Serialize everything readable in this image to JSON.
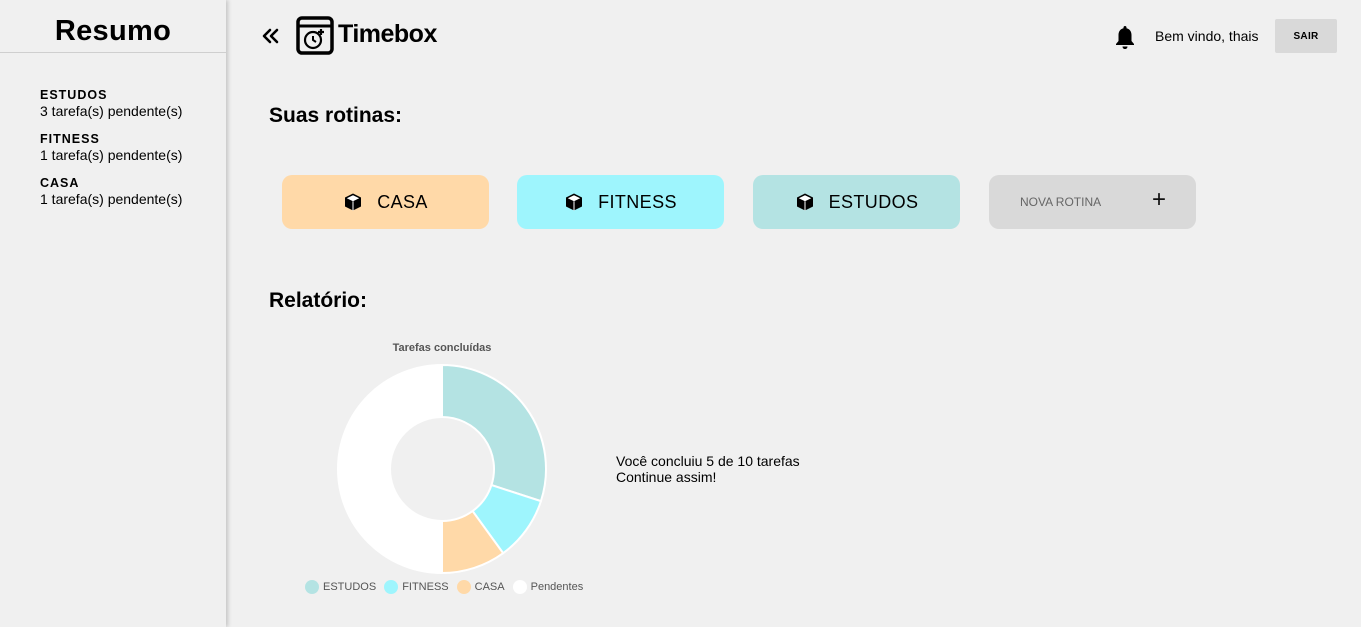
{
  "sidebar": {
    "title": "Resumo",
    "items": [
      {
        "name": "ESTUDOS",
        "count": "3 tarefa(s) pendente(s)"
      },
      {
        "name": "FITNESS",
        "count": "1 tarefa(s) pendente(s)"
      },
      {
        "name": "CASA",
        "count": "1 tarefa(s) pendente(s)"
      }
    ]
  },
  "header": {
    "logo_text": "Timebox",
    "welcome": "Bem vindo, thais",
    "logout_label": "SAIR"
  },
  "routines": {
    "title": "Suas rotinas:",
    "items": [
      {
        "label": "CASA",
        "color": "#ffd9a8"
      },
      {
        "label": "FITNESS",
        "color": "#9ef5fd"
      },
      {
        "label": "ESTUDOS",
        "color": "#b4e3e3"
      }
    ],
    "new_label": "NOVA ROTINA",
    "new_icon": "+"
  },
  "report": {
    "title": "Relatório:",
    "summary_line1": "Você concluiu 5 de 10 tarefas",
    "summary_line2": "Continue assim!"
  },
  "chart_data": {
    "type": "pie",
    "title": "Tarefas concluídas",
    "categories": [
      "ESTUDOS",
      "FITNESS",
      "CASA",
      "Pendentes"
    ],
    "values": [
      3,
      1,
      1,
      5
    ],
    "colors": [
      "#b4e3e3",
      "#9ef5fd",
      "#ffd9a8",
      "#ffffff"
    ],
    "legend": "bottom"
  }
}
